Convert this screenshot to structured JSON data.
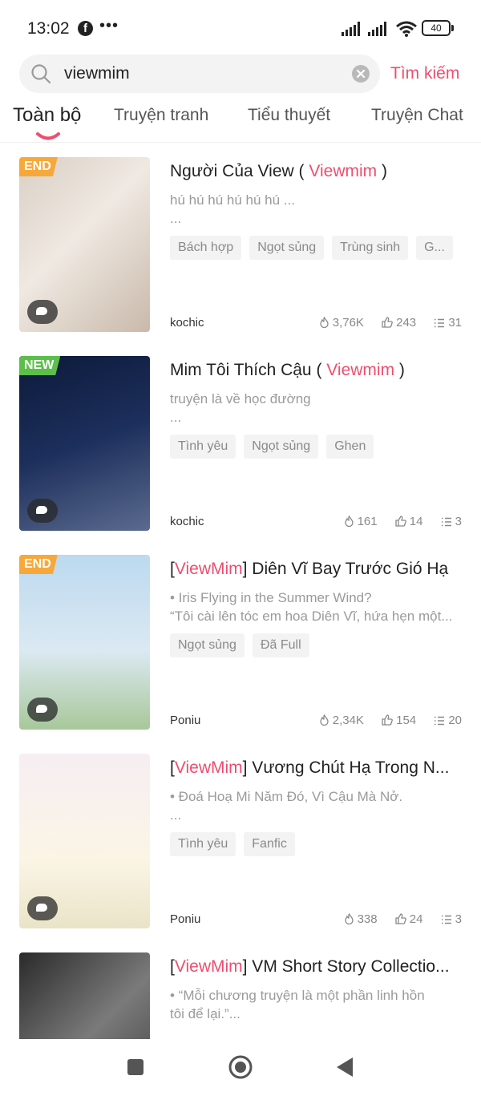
{
  "status": {
    "time": "13:02",
    "fb": "f",
    "more": "•••",
    "battery": "40"
  },
  "search": {
    "query": "viewmim",
    "submit_label": "Tìm kiếm"
  },
  "tabs": [
    {
      "label": "Toàn bộ"
    },
    {
      "label": "Truyện tranh"
    },
    {
      "label": "Tiểu thuyết"
    },
    {
      "label": "Truyện Chat"
    }
  ],
  "colors": {
    "accent": "#ef4d6f",
    "badge_end": "#f7a83a",
    "badge_new": "#5cbf4a"
  },
  "items": [
    {
      "badge": "END",
      "title_pre": "Người Của View ( ",
      "title_hl": "Viewmim",
      "title_post": " )",
      "desc": [
        "hú hú hú hú hú hú ...",
        "..."
      ],
      "tags": [
        "Bách hợp",
        "Ngọt sủng",
        "Trùng sinh",
        "G..."
      ],
      "author": "kochic",
      "views": "3,76K",
      "likes": "243",
      "chapters": "31"
    },
    {
      "badge": "NEW",
      "title_pre": "Mim Tôi Thích Cậu ( ",
      "title_hl": "Viewmim",
      "title_post": " )",
      "desc": [
        "truyện là về học đường",
        "..."
      ],
      "tags": [
        "Tình yêu",
        "Ngọt sủng",
        "Ghen"
      ],
      "author": "kochic",
      "views": "161",
      "likes": "14",
      "chapters": "3"
    },
    {
      "badge": "END",
      "title_pre": "[",
      "title_hl": "ViewMim",
      "title_post": "] Diên Vĩ Bay Trước Gió Hạ",
      "desc": [
        "• Iris Flying in the Summer Wind?",
        "“Tôi cài lên tóc em hoa Diên Vĩ, hứa hẹn một..."
      ],
      "tags": [
        "Ngọt sủng",
        "Đã Full"
      ],
      "author": "Poniu",
      "views": "2,34K",
      "likes": "154",
      "chapters": "20"
    },
    {
      "badge": "",
      "title_pre": "[",
      "title_hl": "ViewMim",
      "title_post": "] Vương Chút Hạ Trong N...",
      "desc": [
        "• Đoá Hoạ Mi Năm Đó, Vì Cậu Mà Nở.",
        "..."
      ],
      "tags": [
        "Tình yêu",
        "Fanfic"
      ],
      "author": "Poniu",
      "views": "338",
      "likes": "24",
      "chapters": "3"
    },
    {
      "badge": "",
      "title_pre": "[",
      "title_hl": "ViewMim",
      "title_post": "] VM Short Story Collectio...",
      "desc": [
        "• “Mỗi chương truyện là một phần linh hồn",
        "tôi để lại.”..."
      ],
      "tags": [],
      "author": "",
      "views": "",
      "likes": "",
      "chapters": ""
    }
  ]
}
